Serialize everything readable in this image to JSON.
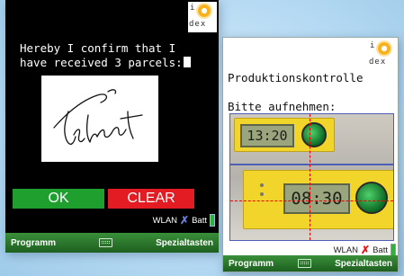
{
  "left_device": {
    "confirm_line1": "Hereby I confirm that I",
    "confirm_line2": "have received 3 parcels:",
    "ok_label": "OK",
    "clear_label": "CLEAR",
    "wlan_label": "WLAN",
    "batt_label": "Batt",
    "softkey_left": "Programm",
    "softkey_right": "Spezialtasten"
  },
  "right_device": {
    "title": "Produktionskontrolle",
    "prompt": "Bitte aufnehmen:",
    "lcd_top": "13:20",
    "lcd_bottom": "08:30",
    "wlan_label": "WLAN",
    "batt_label": "Batt",
    "softkey_left": "Programm",
    "softkey_right": "Spezialtasten"
  },
  "logo": {
    "i": "i",
    "dex": "dex"
  },
  "colors": {
    "ok": "#1f9f2d",
    "clear": "#e31b23",
    "softbar": "#2b7a2d",
    "battery": "#2cb43a"
  },
  "icons": [
    "logo-sun-icon",
    "wlan-off-icon",
    "battery-icon",
    "keyboard-icon"
  ]
}
